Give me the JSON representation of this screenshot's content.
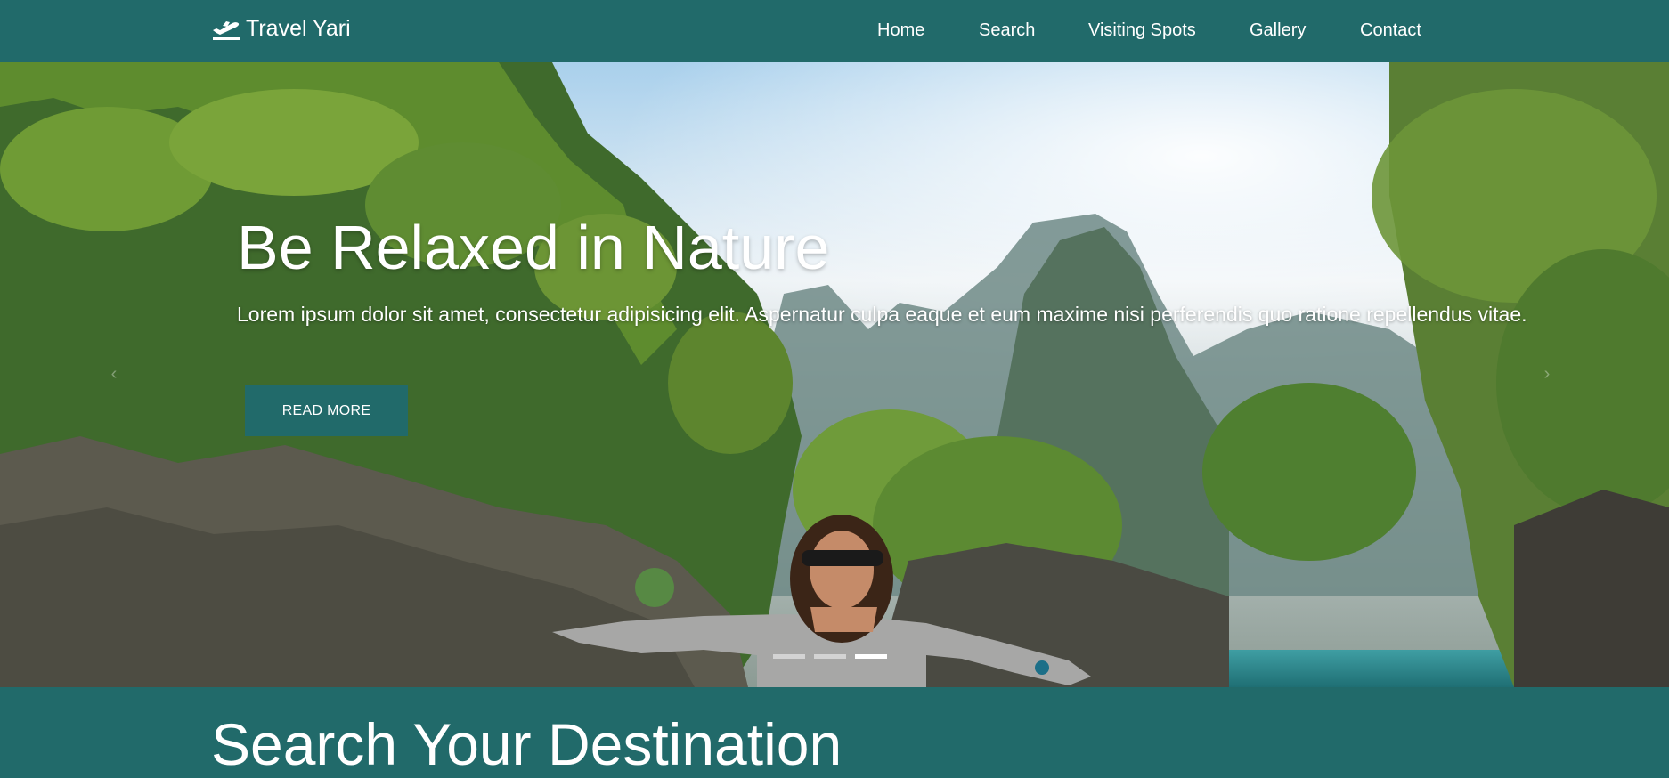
{
  "navbar": {
    "brand_icon": "plane-takeoff-icon",
    "brand": "Travel Yari",
    "links": [
      "Home",
      "Search",
      "Visiting Spots",
      "Gallery",
      "Contact"
    ]
  },
  "hero": {
    "title": "Be Relaxed in Nature",
    "text": "Lorem ipsum dolor sit amet, consectetur adipisicing elit. Aspernatur culpa eaque et eum maxime nisi perferendis quo ratione repellendus vitae.",
    "button_label": "READ MORE",
    "slide_count": 3,
    "active_slide": 3
  },
  "search_section": {
    "title": "Search Your Destination"
  },
  "colors": {
    "primary": "#216a6a",
    "text": "#ffffff"
  }
}
